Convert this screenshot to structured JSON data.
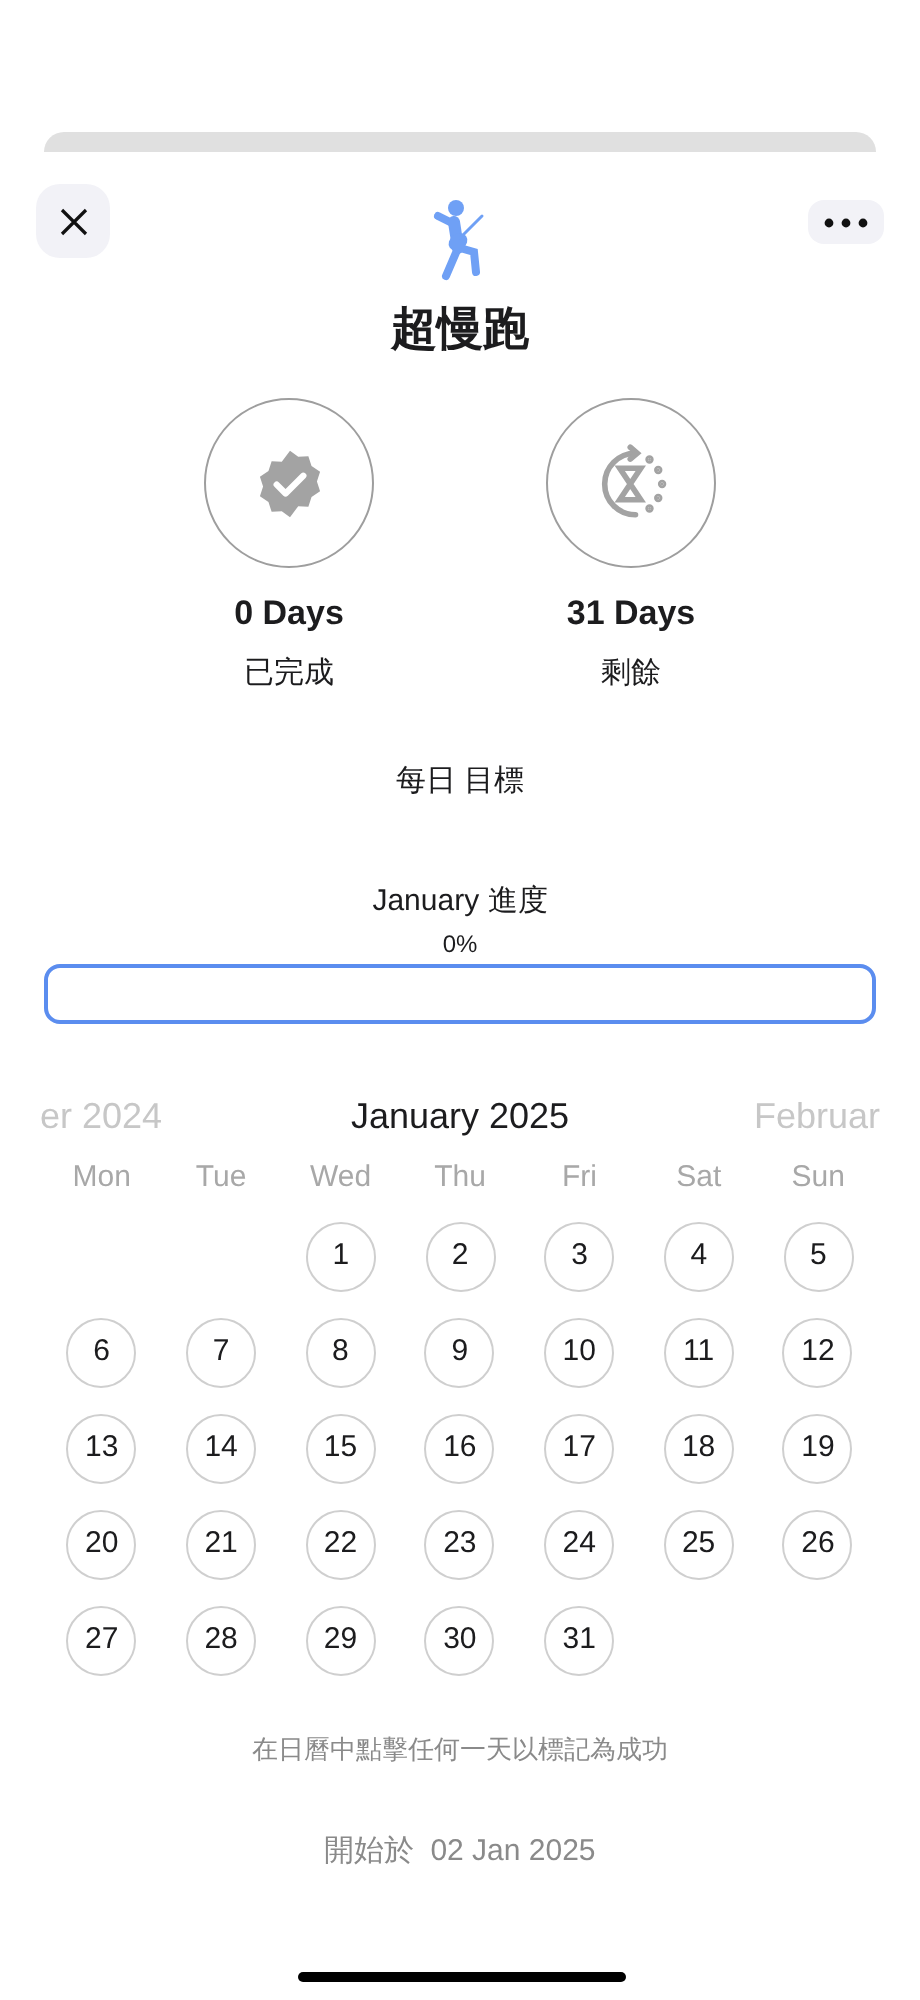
{
  "title": "超慢跑",
  "stats": [
    {
      "kind": "completed",
      "value": "0 Days",
      "label": "已完成"
    },
    {
      "kind": "remaining",
      "value": "31 Days",
      "label": "剩餘"
    }
  ],
  "daily_goal": "每日 目標",
  "progress": {
    "label": "January 進度",
    "reading": "0%",
    "level": 0
  },
  "calendar": {
    "previous_month": "er 2024",
    "month": "January 2025",
    "next_month": "Februar",
    "weekdays": [
      "Mon",
      "Tue",
      "Wed",
      "Thu",
      "Fri",
      "Sat",
      "Sun"
    ],
    "weeks": [
      {
        "kind": "first",
        "days": [
          "1",
          "2",
          "3",
          "4",
          "5"
        ]
      },
      {
        "kind": "regular",
        "days": [
          "6",
          "7",
          "8",
          "9",
          "10",
          "11",
          "12"
        ]
      },
      {
        "kind": "regular",
        "days": [
          "13",
          "14",
          "15",
          "16",
          "17",
          "18",
          "19"
        ]
      },
      {
        "kind": "regular",
        "days": [
          "20",
          "21",
          "22",
          "23",
          "24",
          "25",
          "26"
        ]
      },
      {
        "kind": "regular",
        "days": [
          "27",
          "28",
          "29",
          "30",
          "31"
        ]
      }
    ]
  },
  "hint": "在日曆中點擊任何一天以標記為成功",
  "start": {
    "label": "開始於",
    "date": "02 Jan 2025"
  }
}
